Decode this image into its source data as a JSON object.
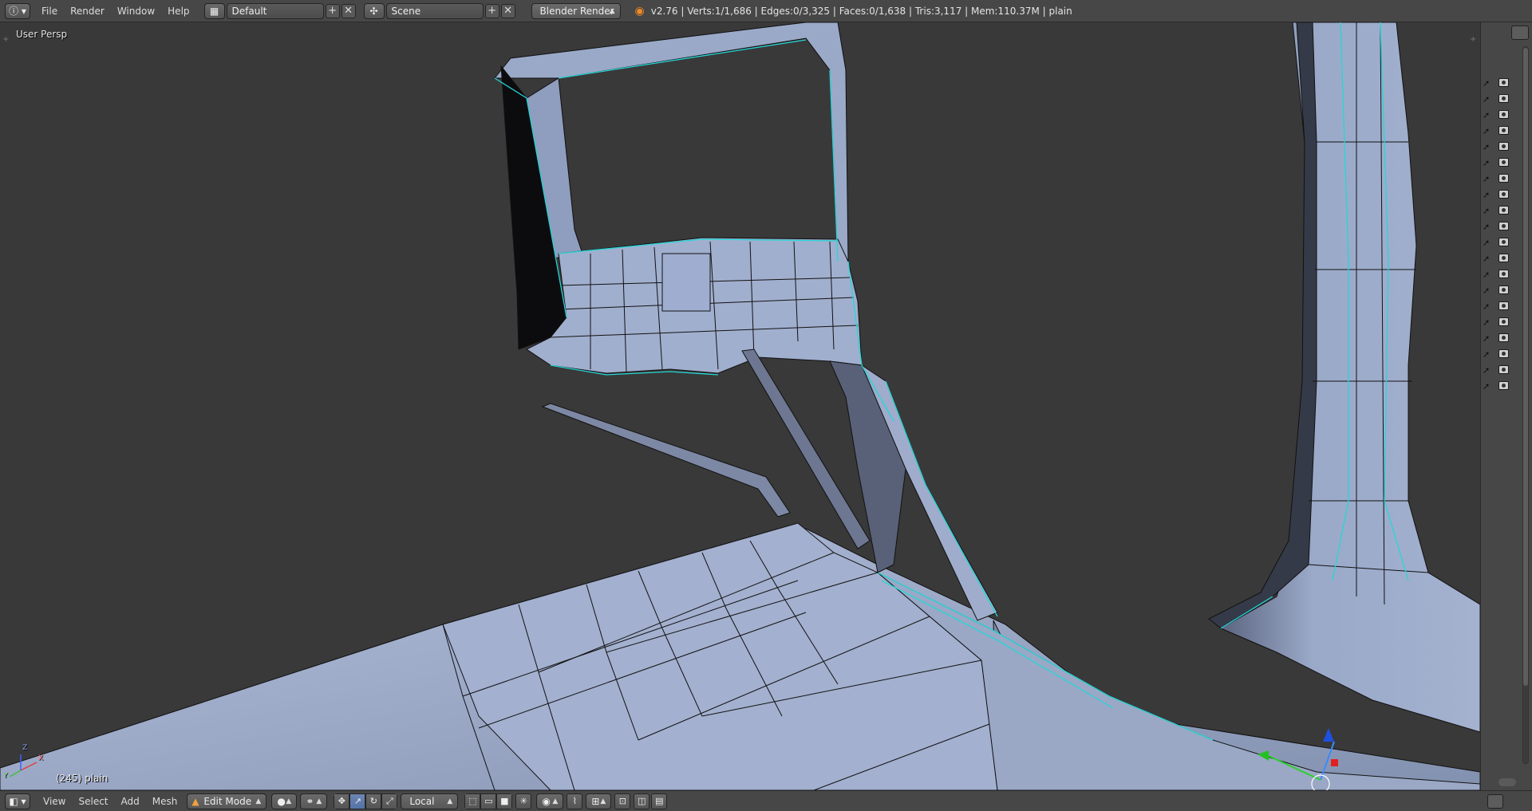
{
  "top_header": {
    "menus": [
      "File",
      "Render",
      "Window",
      "Help"
    ],
    "layout_name": "Default",
    "scene_name": "Scene",
    "render_engine": "Blender Render",
    "stats": "v2.76 | Verts:1/1,686 | Edges:0/3,325 | Faces:0/1,638 | Tris:3,117 | Mem:110.37M | plain"
  },
  "viewport": {
    "view_name": "User Persp",
    "frame_info": "(245) plain",
    "axis_labels": {
      "x": "X",
      "y": "Y",
      "z": "Z"
    }
  },
  "bottom_header": {
    "menus": [
      "View",
      "Select",
      "Add",
      "Mesh"
    ],
    "mode": "Edit Mode",
    "transform_orientation": "Local"
  },
  "colors": {
    "background": "#393939",
    "mesh_face": "#94a3c2",
    "mesh_edge": "#0a0a0a",
    "mesh_seam": "#27d6d6",
    "header": "#474747"
  }
}
